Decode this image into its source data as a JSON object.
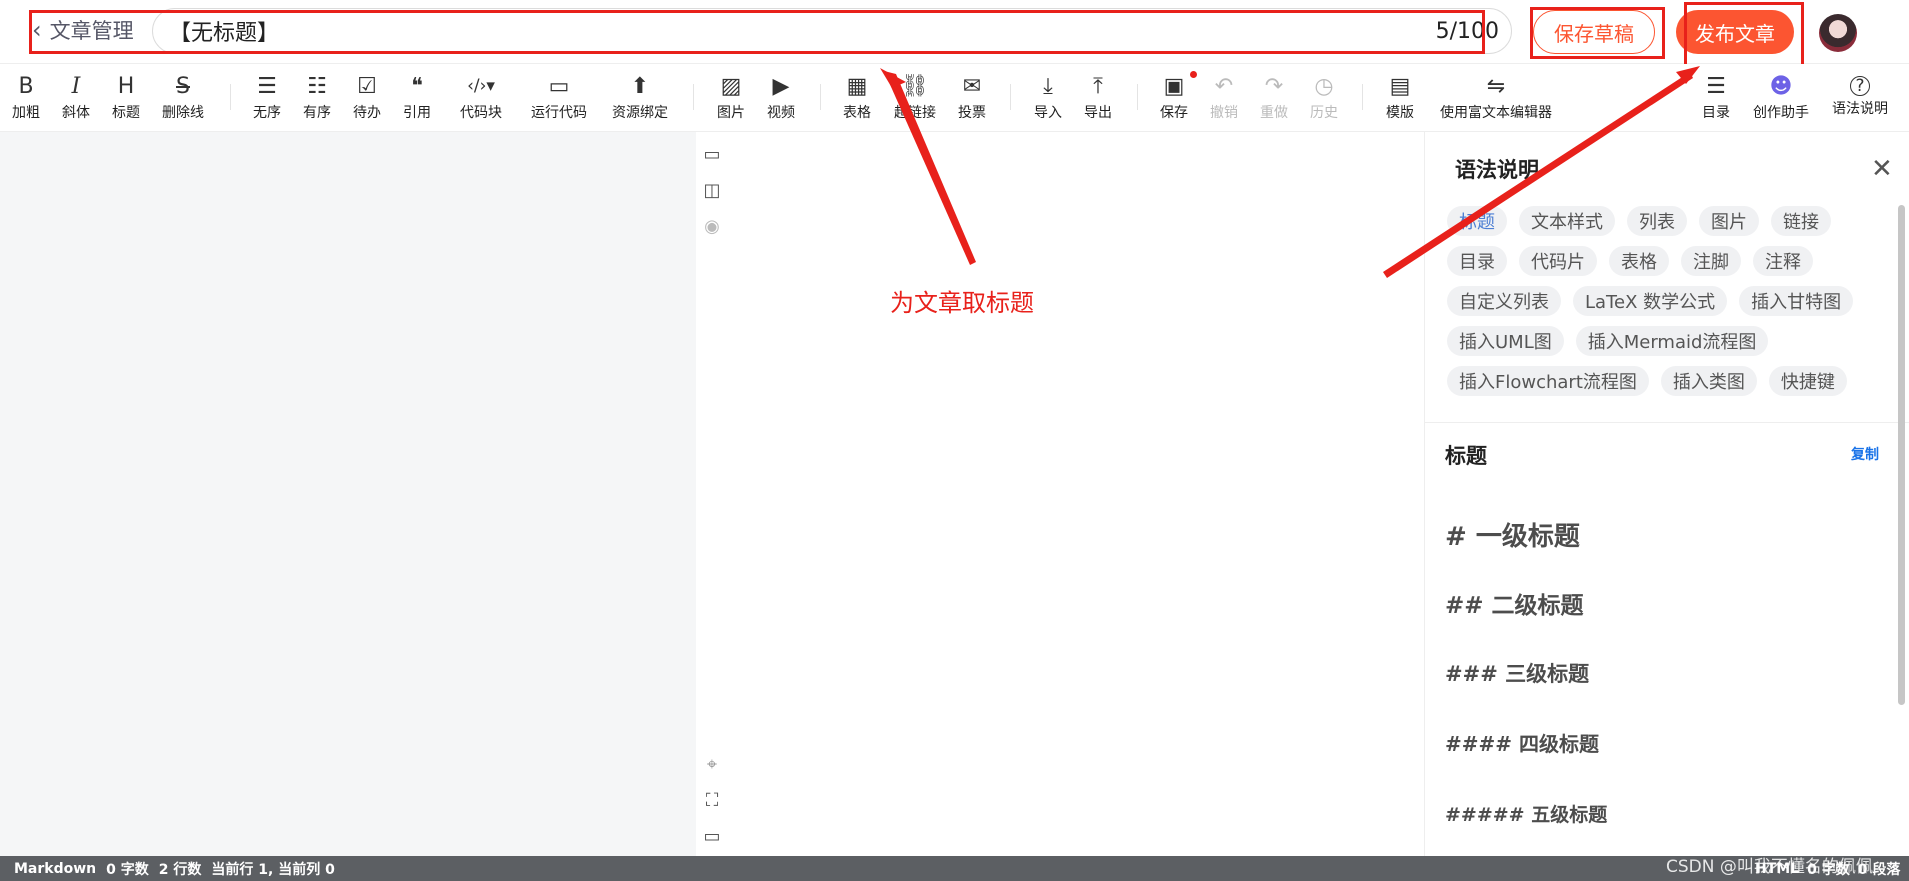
{
  "header": {
    "back_label": "文章管理",
    "title_value": "【无标题】",
    "char_count": "5/100",
    "save_draft_label": "保存草稿",
    "publish_label": "发布文章"
  },
  "toolbar": {
    "items": [
      {
        "label": "加粗",
        "icon": "B"
      },
      {
        "label": "斜体",
        "icon": "I"
      },
      {
        "label": "标题",
        "icon": "H"
      },
      {
        "label": "删除线",
        "icon": "S"
      },
      {
        "label": "无序",
        "icon": "☰"
      },
      {
        "label": "有序",
        "icon": "☷"
      },
      {
        "label": "待办",
        "icon": "☑"
      },
      {
        "label": "引用",
        "icon": "❝"
      },
      {
        "label": "代码块",
        "icon": "‹/›▾"
      },
      {
        "label": "运行代码",
        "icon": "▭"
      },
      {
        "label": "资源绑定",
        "icon": "⬆"
      },
      {
        "label": "图片",
        "icon": "▨"
      },
      {
        "label": "视频",
        "icon": "▶"
      },
      {
        "label": "表格",
        "icon": "▦"
      },
      {
        "label": "超链接",
        "icon": "⛓"
      },
      {
        "label": "投票",
        "icon": "✉"
      },
      {
        "label": "导入",
        "icon": "⤓"
      },
      {
        "label": "导出",
        "icon": "⤒"
      },
      {
        "label": "保存",
        "icon": "▣"
      },
      {
        "label": "撤销",
        "icon": "↶"
      },
      {
        "label": "重做",
        "icon": "↷"
      },
      {
        "label": "历史",
        "icon": "◷"
      },
      {
        "label": "模版",
        "icon": "▤"
      },
      {
        "label": "使用富文本编辑器",
        "icon": "⇋"
      },
      {
        "label": "目录",
        "icon": "☰"
      },
      {
        "label": "创作助手",
        "icon": "☻"
      },
      {
        "label": "语法说明",
        "icon": "?"
      }
    ]
  },
  "annotation": {
    "text": "为文章取标题"
  },
  "syntax_panel": {
    "title": "语法说明",
    "tags": [
      "标题",
      "文本样式",
      "列表",
      "图片",
      "链接",
      "目录",
      "代码片",
      "表格",
      "注脚",
      "注释",
      "自定义列表",
      "LaTeX 数学公式",
      "插入甘特图",
      "插入UML图",
      "插入Mermaid流程图",
      "插入Flowchart流程图",
      "插入类图",
      "快捷键"
    ],
    "active_tag": "标题",
    "section_title": "标题",
    "copy_label": "复制",
    "headings": [
      "# 一级标题",
      "## 二级标题",
      "### 三级标题",
      "#### 四级标题",
      "##### 五级标题"
    ]
  },
  "status_bar": {
    "mode": "Markdown",
    "words": "0 字数",
    "lines": "2 行数",
    "cursor": "当前行 1, 当前列 0",
    "right_mode": "HTML",
    "right_words": "0 字数",
    "right_paragraphs": "0 段落"
  },
  "watermark": "CSDN @叫我不懂名的佩佩",
  "colors": {
    "accent": "#fc5531",
    "annotation_red": "#e8211b",
    "link_blue": "#1a73e8"
  }
}
